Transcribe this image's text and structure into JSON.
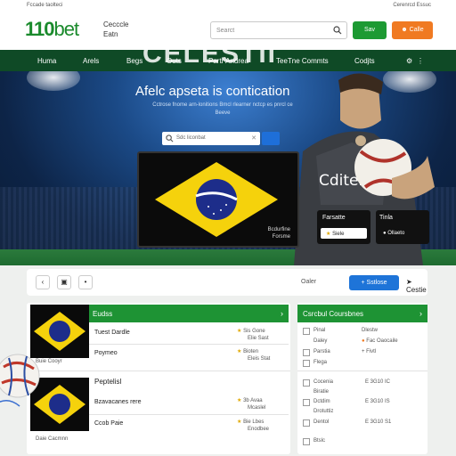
{
  "topbar": {
    "left_text": "Fccade taolteci",
    "right_text": "Cerenrcd  Essuc"
  },
  "header": {
    "logo_num": "110",
    "logo_word": "bet",
    "tagline": "Cecccle Eatn",
    "search_placeholder": "Searct",
    "btn_primary": "Sav",
    "btn_secondary": "Calle"
  },
  "nav": {
    "items": [
      "Huma",
      "Arels",
      "Begs",
      "Outs",
      "Partr Andrea",
      "TeeTne Commts",
      "Codjts"
    ],
    "ghost": "CELESTII"
  },
  "hero": {
    "title": "Afelc apseta is contication",
    "subtitle": "Cctrose fnome arn-lonitions Bmcl rlearner nctcp es pnrcl ce Beeve",
    "search_placeholder": "Sdc liconbat",
    "video_caption_1": "Bcdurfine",
    "video_caption_2": "Forsme",
    "card_a_title": "Farsatte",
    "card_a_pill": "Siele",
    "card_b_title": "Tinla",
    "card_b_pill": "Ollaeto",
    "jersey_text": "Cditer"
  },
  "toolbar": {
    "label": "Oaler",
    "blue_button": "Sstlose",
    "share": "Cestie"
  },
  "left_panel": {
    "header_title": "Eudss",
    "rows": [
      {
        "name": "Tuest Dardle",
        "meta": "Sis Gone",
        "sub": "Elie Sast"
      },
      {
        "name": "Poymeo",
        "meta": "Bioten",
        "sub": "Eleis Stat"
      }
    ],
    "flag_caption": "Buie Cooyr",
    "section2_title": "Peptelisl",
    "rows2": [
      {
        "name": "Bzavacanes rere",
        "meta": "3b Avaa",
        "sub": "Mcaslel"
      },
      {
        "name": "Ccob Paie",
        "meta": "Bie Lbes",
        "sub": "Enodbee"
      }
    ],
    "flag_caption2": "Daie Cacmnn"
  },
  "right_panel": {
    "header_title": "Csrcbul Coursbnes",
    "list1": [
      {
        "a": "Pinal",
        "b": "Dlestw"
      },
      {
        "a": "Daley",
        "b": "Fac Oaocaile"
      },
      {
        "a": "Parstia",
        "b": "Fivtl"
      },
      {
        "a": "Flega",
        "b": ""
      }
    ],
    "list2": [
      {
        "a": "Cocenia",
        "b": "E 3G10 IC"
      },
      {
        "a": "Biratie",
        "b": ""
      },
      {
        "a": "Dctdim",
        "b": "E 3G10 IS"
      },
      {
        "a": "Drotuttiz",
        "b": ""
      },
      {
        "a": "Dentol",
        "b": "E 3G10 S1"
      },
      {
        "a": "Btslc",
        "b": ""
      }
    ]
  },
  "colors": {
    "brand_green": "#1e9334",
    "nav_green": "#0f4a26",
    "accent_orange": "#f07a22",
    "accent_blue": "#1e74d8"
  }
}
